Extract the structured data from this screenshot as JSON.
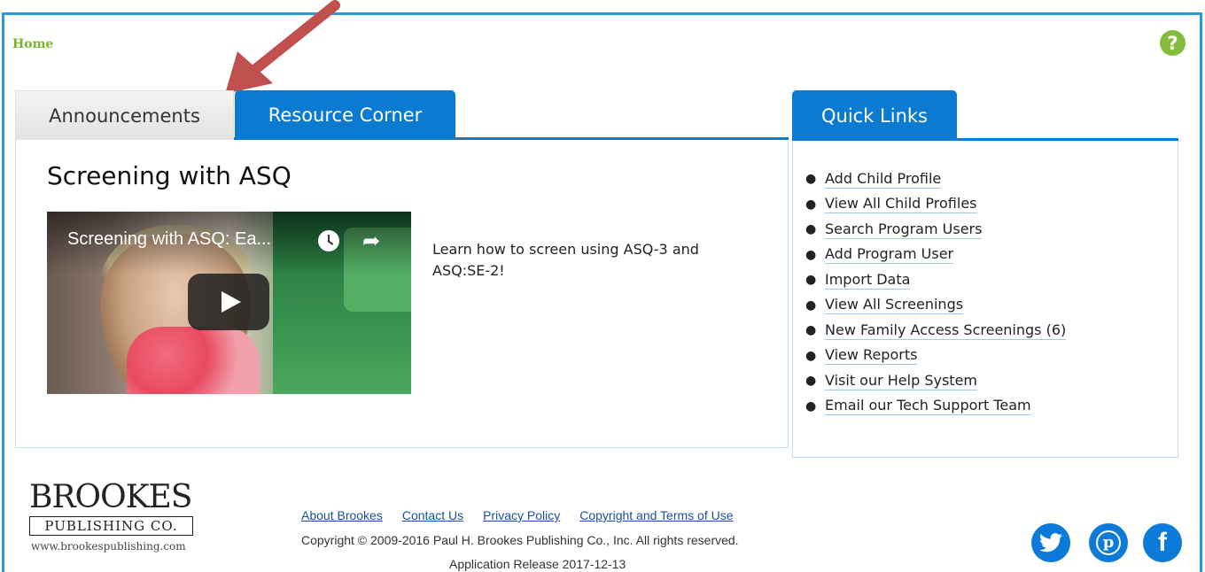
{
  "breadcrumb": {
    "home": "Home"
  },
  "help": {
    "glyph": "?"
  },
  "tabs": {
    "announcements": "Announcements",
    "resource_corner": "Resource Corner"
  },
  "resource": {
    "title": "Screening with ASQ",
    "video_title": "Screening with ASQ: Ea...",
    "description": "Learn how to screen using ASQ-3 and ASQ:SE-2!"
  },
  "quick_links": {
    "tab": "Quick Links",
    "items": [
      {
        "label": "Add Child Profile"
      },
      {
        "label": "View All Child Profiles"
      },
      {
        "label": "Search Program Users"
      },
      {
        "label": "Add Program User"
      },
      {
        "label": "Import Data"
      },
      {
        "label": "View All Screenings"
      },
      {
        "label": "New Family Access Screenings (6)"
      },
      {
        "label": "View Reports"
      },
      {
        "label": "Visit our Help System"
      },
      {
        "label": "Email our Tech Support Team"
      }
    ]
  },
  "footer": {
    "brand_name": "BROOKES",
    "brand_sub": "PUBLISHING CO.",
    "brand_url": "www.brookespublishing.com",
    "links": [
      "About Brookes",
      "Contact Us",
      "Privacy Policy",
      "Copyright and Terms of Use"
    ],
    "copyright": "Copyright © 2009-2016 Paul H. Brookes Publishing Co., Inc. All rights reserved.",
    "release": "Application Release 2017-12-13"
  },
  "colors": {
    "accent": "#0b7bd2",
    "frame": "#2a9ad3",
    "breadcrumb": "#7ab32e",
    "help": "#86bc3e",
    "arrow": "#c0504d"
  },
  "icons": {
    "help": "question-circle-icon",
    "video_clock": "clock-icon",
    "video_share": "share-icon",
    "video_play": "play-icon",
    "social": [
      "twitter-icon",
      "pinterest-icon",
      "facebook-icon"
    ]
  }
}
